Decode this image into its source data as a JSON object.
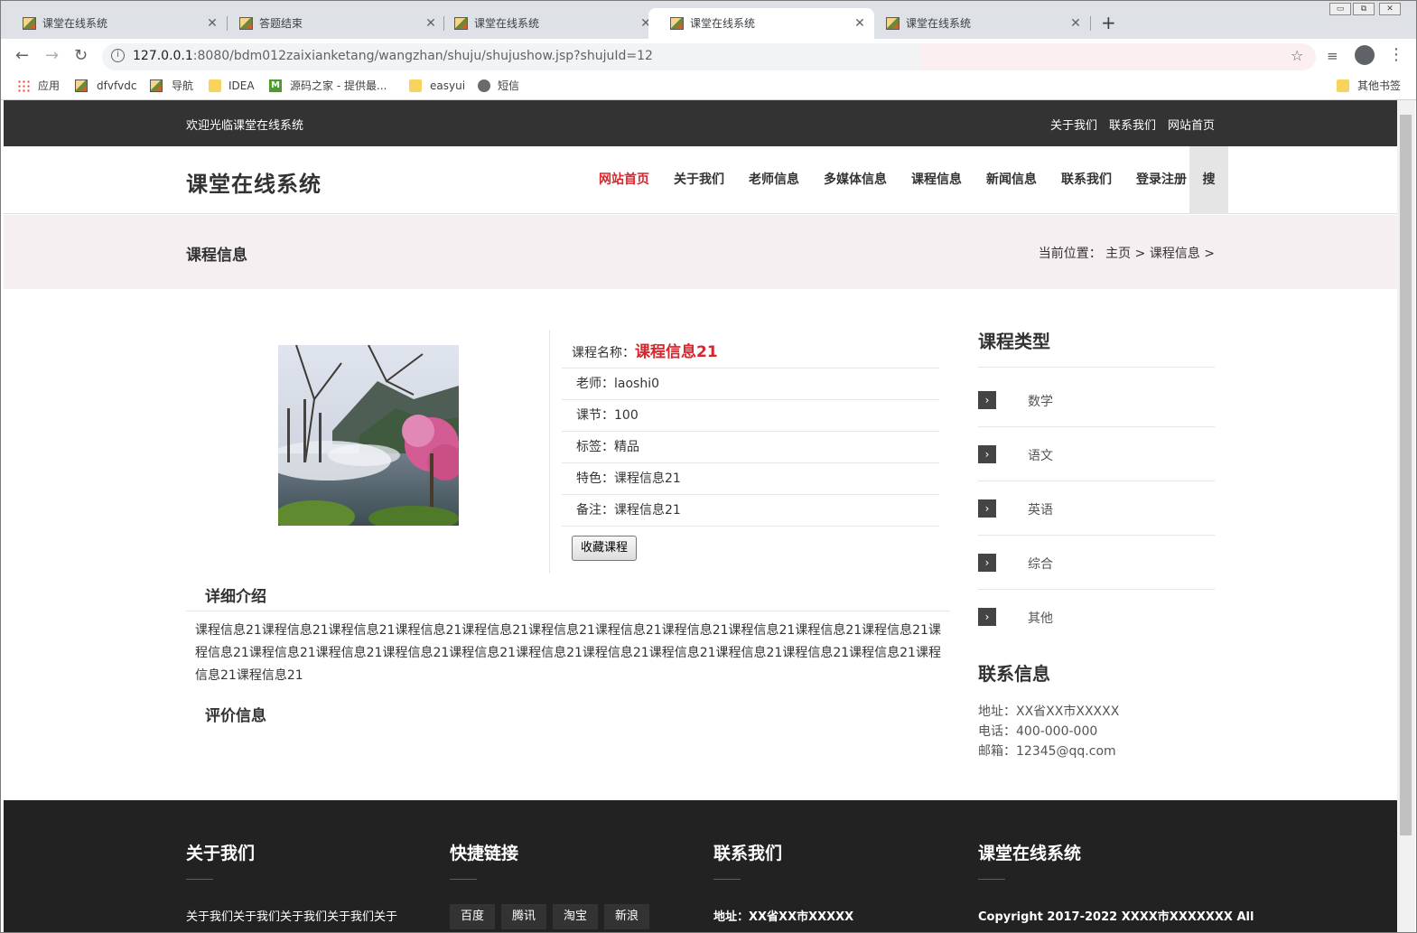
{
  "browser": {
    "tabs": [
      {
        "title": "课堂在线系统"
      },
      {
        "title": "答题结束"
      },
      {
        "title": "课堂在线系统"
      },
      {
        "title": "课堂在线系统"
      },
      {
        "title": "课堂在线系统"
      }
    ],
    "active_tab": 3,
    "url_host": "127.0.0.1",
    "url_rest": ":8080/bdm012zaixianketang/wangzhan/shuju/shujushow.jsp?shujuId=12",
    "bookmarks": [
      "应用",
      "dfvfvdc",
      "导航",
      "IDEA",
      "源码之家 - 提供最...",
      "easyui",
      "短信"
    ],
    "other_bookmarks": "其他书签"
  },
  "topbar": {
    "welcome": "欢迎光临课堂在线系统",
    "links": [
      "关于我们",
      "联系我们",
      "网站首页"
    ]
  },
  "header": {
    "logo": "课堂在线系统",
    "nav": [
      "网站首页",
      "关于我们",
      "老师信息",
      "多媒体信息",
      "课程信息",
      "新闻信息",
      "联系我们",
      "登录注册"
    ],
    "search": "搜"
  },
  "crumb": {
    "title": "课程信息",
    "path": "当前位置： 主页 > 课程信息 >"
  },
  "course": {
    "name_label": "课程名称：",
    "name": "课程信息21",
    "fields": [
      {
        "label": "老师：",
        "value": "laoshi0"
      },
      {
        "label": "课节：",
        "value": "100"
      },
      {
        "label": "标签：",
        "value": "精品"
      },
      {
        "label": "特色：",
        "value": "课程信息21"
      },
      {
        "label": "备注：",
        "value": "课程信息21"
      }
    ],
    "favorite_button": "收藏课程",
    "detail_heading": "详细介绍",
    "detail_text": "课程信息21课程信息21课程信息21课程信息21课程信息21课程信息21课程信息21课程信息21课程信息21课程信息21课程信息21课程信息21课程信息21课程信息21课程信息21课程信息21课程信息21课程信息21课程信息21课程信息21课程信息21课程信息21课程信息21课程信息21",
    "review_heading": "评价信息"
  },
  "sidebar": {
    "types_heading": "课程类型",
    "types": [
      "数学",
      "语文",
      "英语",
      "综合",
      "其他"
    ],
    "contact_heading": "联系信息",
    "contact": [
      "地址：XX省XX市XXXXX",
      "电话：400-000-000",
      "邮箱：12345@qq.com"
    ]
  },
  "footer": {
    "about_heading": "关于我们",
    "about_text": "关于我们关于我们关于我们关于我们关于",
    "links_heading": "快捷链接",
    "links": [
      "百度",
      "腾讯",
      "淘宝",
      "新浪"
    ],
    "contact_heading": "联系我们",
    "contact_text": "地址：XX省XX市XXXXX",
    "site_heading": "课堂在线系统",
    "copyright": "Copyright 2017-2022 XXXX市XXXXXXX All"
  },
  "colors": {
    "accent": "#d9262c",
    "topbar": "#333333",
    "footer": "#222222",
    "crumb_bg": "#f6eff2"
  }
}
